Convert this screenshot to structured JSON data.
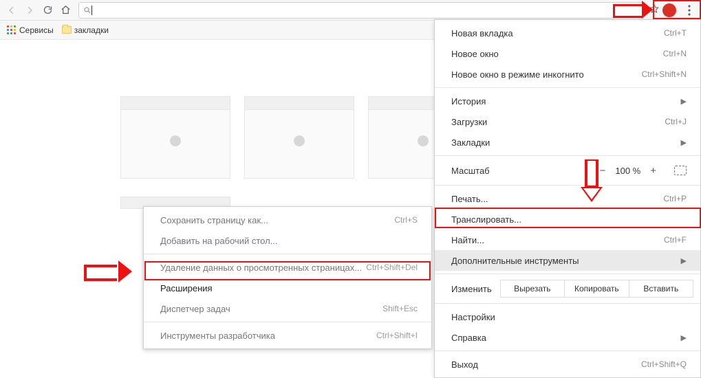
{
  "toolbar": {
    "url_value": "",
    "url_placeholder": ""
  },
  "bookmarks": {
    "apps": "Сервисы",
    "folder": "закладки"
  },
  "main_menu": {
    "new_tab": "Новая вкладка",
    "new_tab_sc": "Ctrl+T",
    "new_window": "Новое окно",
    "new_window_sc": "Ctrl+N",
    "incognito": "Новое окно в режиме инкогнито",
    "incognito_sc": "Ctrl+Shift+N",
    "history": "История",
    "downloads": "Загрузки",
    "downloads_sc": "Ctrl+J",
    "bookmarks": "Закладки",
    "zoom_label": "Масштаб",
    "zoom_value": "100 %",
    "print": "Печать...",
    "print_sc": "Ctrl+P",
    "cast": "Транслировать...",
    "find": "Найти...",
    "find_sc": "Ctrl+F",
    "more_tools": "Дополнительные инструменты",
    "edit_label": "Изменить",
    "cut": "Вырезать",
    "copy": "Копировать",
    "paste": "Вставить",
    "settings": "Настройки",
    "help": "Справка",
    "exit": "Выход",
    "exit_sc": "Ctrl+Shift+Q"
  },
  "submenu": {
    "save_as": "Сохранить страницу как...",
    "save_as_sc": "Ctrl+S",
    "add_desktop": "Добавить на рабочий стол...",
    "clear_data": "Удаление данных о просмотренных страницах...",
    "clear_data_sc": "Ctrl+Shift+Del",
    "extensions": "Расширения",
    "task_mgr": "Диспетчер задач",
    "task_mgr_sc": "Shift+Esc",
    "dev_tools": "Инструменты разработчика",
    "dev_tools_sc": "Ctrl+Shift+I"
  }
}
